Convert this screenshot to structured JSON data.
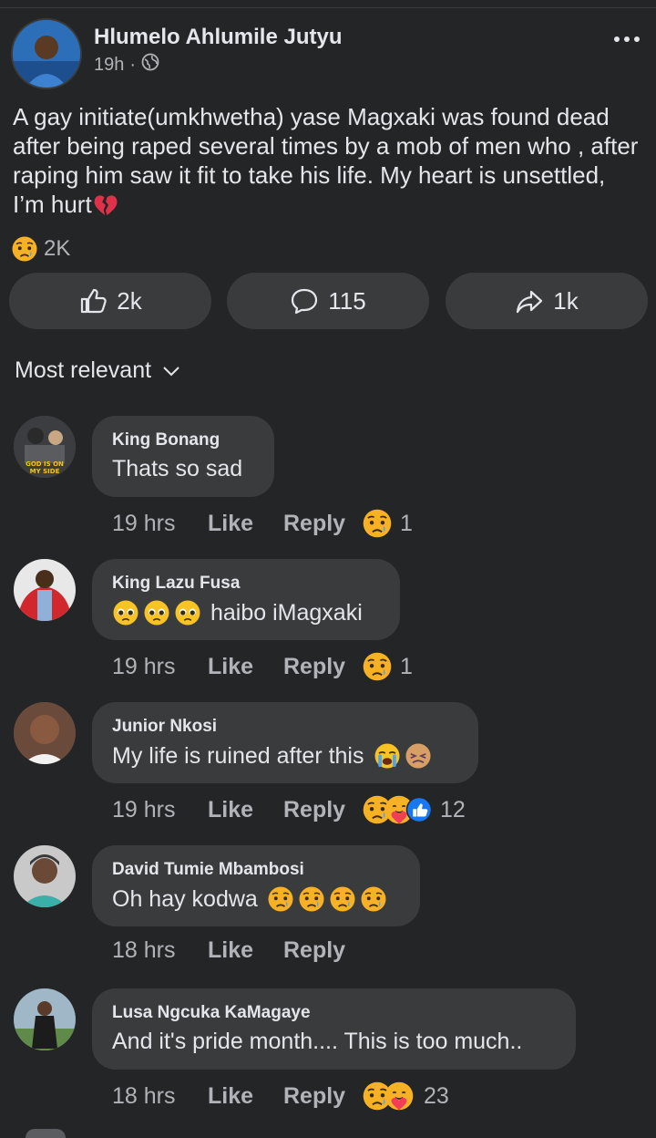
{
  "post": {
    "author": "Hlumelo Ahlumile Jutyu",
    "time": "19h",
    "separator": "·",
    "privacy_icon": "globe-icon",
    "text": "A gay initiate(umkhwetha) yase Magxaki was found dead after being raped several times by a mob of men who , after raping him saw it fit to take his life. My heart is unsettled, I’m hurt",
    "text_emoji": "broken-heart",
    "reaction_icon": "sad-emoji",
    "reaction_count": "2K",
    "like_count": "2k",
    "comment_count": "115",
    "share_count": "1k"
  },
  "sort_label": "Most relevant",
  "comments": [
    {
      "name": "King Bonang",
      "text": "Thats so sad",
      "time": "19 hrs",
      "like": "Like",
      "reply": "Reply",
      "reaction_count": "1",
      "avatar_text": "GOD IS ON MY SIDE"
    },
    {
      "name": "King Lazu Fusa",
      "text": "haibo iMagxaki",
      "time": "19 hrs",
      "like": "Like",
      "reply": "Reply",
      "reaction_count": "1"
    },
    {
      "name": "Junior Nkosi",
      "text": "My life is ruined after this",
      "time": "19 hrs",
      "like": "Like",
      "reply": "Reply",
      "reaction_count": "12"
    },
    {
      "name": "David Tumie Mbambosi",
      "text": "Oh hay kodwa",
      "time": "18 hrs",
      "like": "Like",
      "reply": "Reply",
      "reaction_count": ""
    },
    {
      "name": "Lusa Ngcuka KaMagaye",
      "text": "And it's pride month.... This is too much..",
      "time": "18 hrs",
      "like": "Like",
      "reply": "Reply",
      "reaction_count": "23"
    }
  ],
  "colors": {
    "background": "#242526",
    "bubble": "#3a3b3c",
    "text_primary": "#e4e6eb",
    "text_secondary": "#b0b3b8",
    "like_blue": "#1877f2"
  }
}
